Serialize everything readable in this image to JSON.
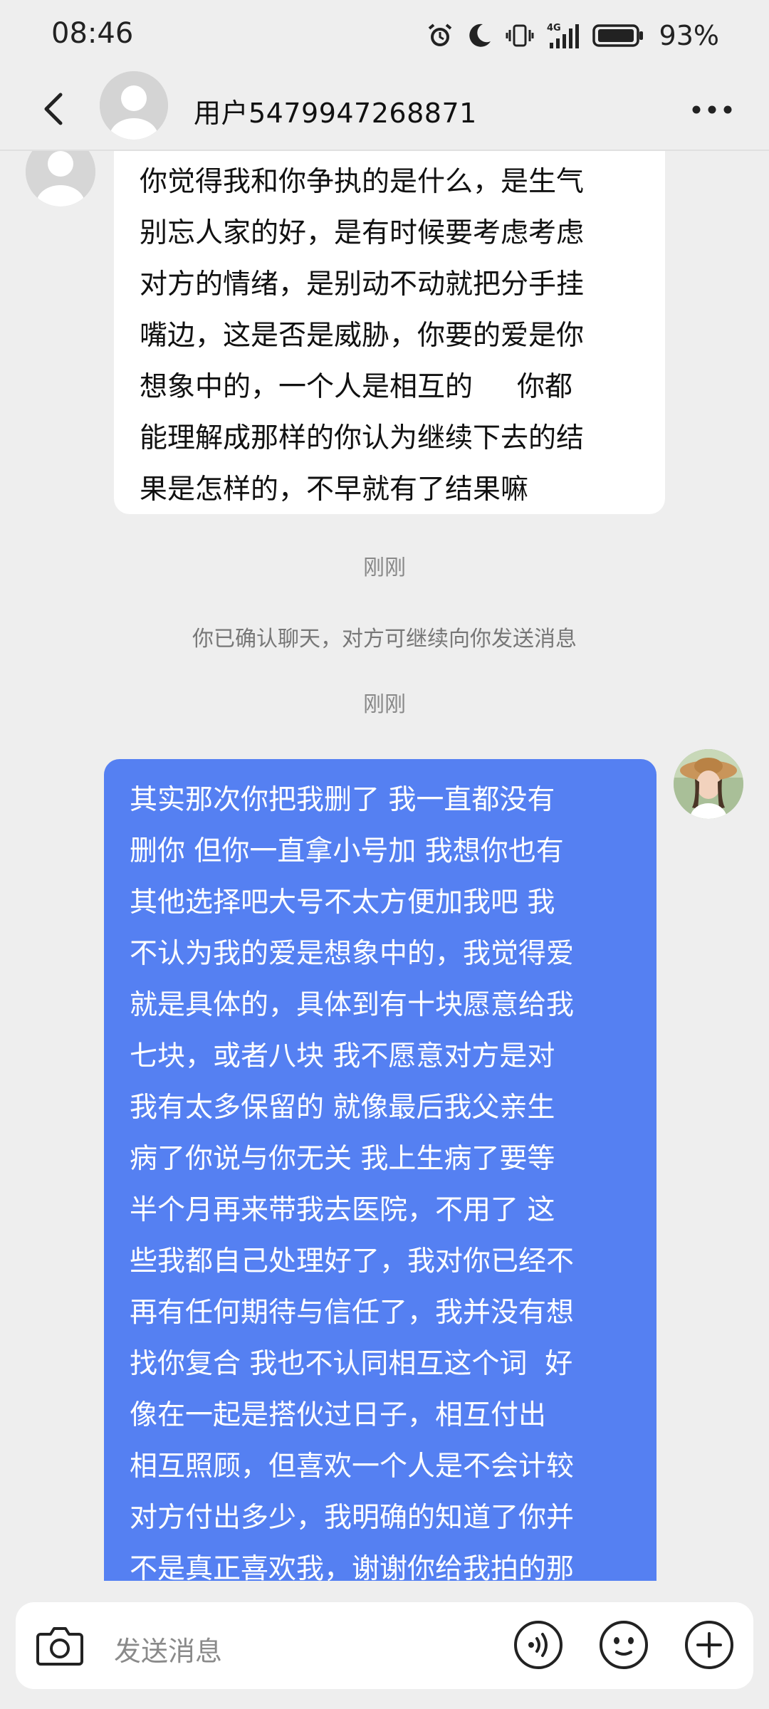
{
  "status_bar": {
    "time": "08:46",
    "network": "4G",
    "battery": "93%"
  },
  "header": {
    "title": "用户5479947268871",
    "back_icon": "chevron-left-icon",
    "more_icon": "more-dots-icon"
  },
  "messages": {
    "incoming_text": "你觉得我和你争执的是什么，是生气\n别忘人家的好，是有时候要考虑考虑\n对方的情绪，是别动不动就把分手挂\n嘴边，这是否是威胁，你要的爱是你\n想象中的，一个人是相互的     你都\n能理解成那样的你认为继续下去的结\n果是怎样的，不早就有了结果嘛",
    "timestamp_1": "刚刚",
    "system_notice": "你已确认聊天，对方可继续向你发送消息",
    "timestamp_2": "刚刚",
    "outgoing_text": "其实那次你把我删了 我一直都没有\n删你 但你一直拿小号加 我想你也有\n其他选择吧大号不太方便加我吧 我\n不认为我的爱是想象中的，我觉得爱\n就是具体的，具体到有十块愿意给我\n七块，或者八块 我不愿意对方是对\n我有太多保留的 就像最后我父亲生\n病了你说与你无关 我上生病了要等\n半个月再来带我去医院，不用了 这\n些我都自己处理好了，我对你已经不\n再有任何期待与信任了，我并没有想\n找你复合 我也不认同相互这个词  好\n像在一起是搭伙过日子，相互付出\n相互照顾，但喜欢一个人是不会计较\n对方付出多少，我明确的知道了你并\n不是真正喜欢我，谢谢你给我拍的那"
  },
  "input_bar": {
    "placeholder": "发送消息",
    "camera_icon": "camera-icon",
    "voice_icon": "voice-icon",
    "emoji_icon": "emoji-icon",
    "plus_icon": "plus-icon"
  },
  "colors": {
    "outgoing_bubble": "#5580f2",
    "incoming_bubble": "#ffffff",
    "background": "#eeeeee"
  }
}
